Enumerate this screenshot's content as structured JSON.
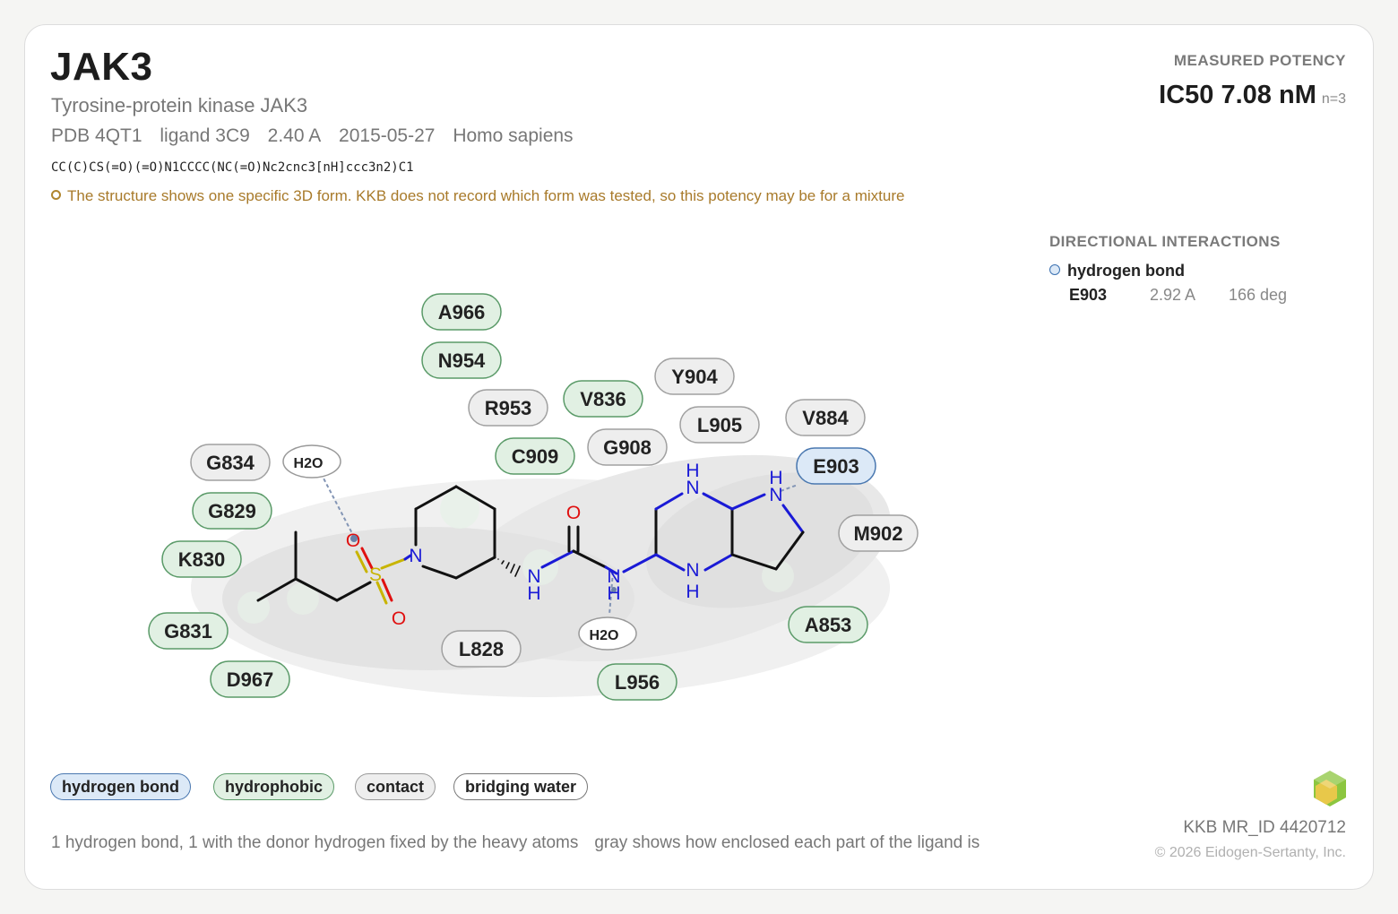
{
  "header": {
    "title": "JAK3",
    "subtitle": "Tyrosine-protein kinase JAK3",
    "meta": {
      "pdb": "PDB 4QT1",
      "ligand": "ligand 3C9",
      "resolution": "2.40 A",
      "date": "2015-05-27",
      "organism": "Homo sapiens"
    },
    "smiles": "CC(C)CS(=O)(=O)N1CCCC(NC(=O)Nc2cnc3[nH]ccc3n2)C1",
    "warning": "The structure shows one specific 3D form. KKB does not record which form was tested, so this potency may be for a mixture"
  },
  "potency": {
    "label": "MEASURED POTENCY",
    "value": "IC50 7.08 nM",
    "n": "n=3"
  },
  "directional_interactions": {
    "title": "DIRECTIONAL INTERACTIONS",
    "type": "hydrogen bond",
    "rows": [
      {
        "residue": "E903",
        "distance": "2.92 A",
        "angle": "166 deg"
      }
    ]
  },
  "diagram": {
    "residues": [
      {
        "label": "A966",
        "kind": "hydrophobic"
      },
      {
        "label": "N954",
        "kind": "hydrophobic"
      },
      {
        "label": "R953",
        "kind": "contact"
      },
      {
        "label": "V836",
        "kind": "hydrophobic"
      },
      {
        "label": "Y904",
        "kind": "contact"
      },
      {
        "label": "V884",
        "kind": "contact"
      },
      {
        "label": "L905",
        "kind": "contact"
      },
      {
        "label": "C909",
        "kind": "hydrophobic"
      },
      {
        "label": "G908",
        "kind": "contact"
      },
      {
        "label": "E903",
        "kind": "hydrogen bond"
      },
      {
        "label": "G834",
        "kind": "contact"
      },
      {
        "label": "G829",
        "kind": "hydrophobic"
      },
      {
        "label": "K830",
        "kind": "hydrophobic"
      },
      {
        "label": "M902",
        "kind": "contact"
      },
      {
        "label": "A853",
        "kind": "hydrophobic"
      },
      {
        "label": "G831",
        "kind": "hydrophobic"
      },
      {
        "label": "L828",
        "kind": "contact"
      },
      {
        "label": "D967",
        "kind": "hydrophobic"
      },
      {
        "label": "L956",
        "kind": "hydrophobic"
      }
    ],
    "waters": [
      "H2O",
      "H2O"
    ],
    "atom_labels": {
      "o": "O",
      "n": "N",
      "h": "H",
      "s": "S"
    }
  },
  "legend": {
    "hydrogen_bond": "hydrogen bond",
    "hydrophobic": "hydrophobic",
    "contact": "contact",
    "bridging_water": "bridging water"
  },
  "footer": {
    "note1": "1 hydrogen bond, 1 with the donor hydrogen fixed by the heavy atoms",
    "note2": "gray shows how enclosed each part of the ligand is",
    "mr_id": "KKB MR_ID 4420712",
    "copyright": "© 2026 Eidogen-Sertanty, Inc."
  },
  "colors": {
    "hbond_fill": "#dce9f7",
    "hbond_stroke": "#4a78b0",
    "hydrophobic_fill": "#e1f0e3",
    "hydrophobic_stroke": "#5a9a68",
    "contact_fill": "#eeeeee",
    "contact_stroke": "#a0a0a0",
    "nitrogen": "#1a1ad6",
    "oxygen": "#e01010",
    "sulfur": "#c8b400",
    "warning": "#a87a2a"
  }
}
